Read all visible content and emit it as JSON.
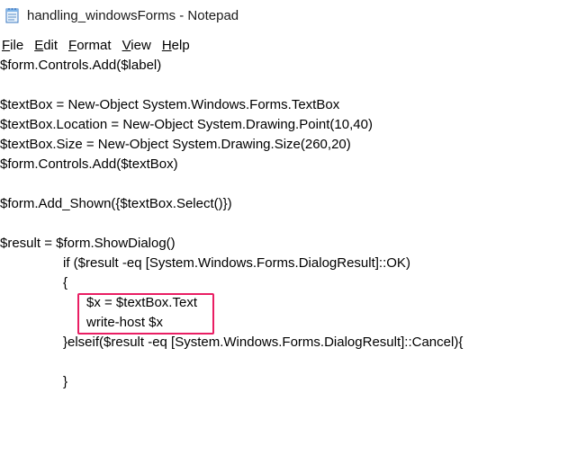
{
  "window": {
    "title": "handling_windowsForms - Notepad",
    "icon": "notepad-icon"
  },
  "menu": {
    "file": "File",
    "edit": "Edit",
    "format": "Format",
    "view": "View",
    "help": "Help"
  },
  "code": {
    "line1": "$form.Controls.Add($label)",
    "line2": "",
    "line3": "$textBox = New-Object System.Windows.Forms.TextBox",
    "line4": "$textBox.Location = New-Object System.Drawing.Point(10,40)",
    "line5": "$textBox.Size = New-Object System.Drawing.Size(260,20)",
    "line6": "$form.Controls.Add($textBox)",
    "line7": "",
    "line8": "$form.Add_Shown({$textBox.Select()})",
    "line9": "",
    "line10": "$result = $form.ShowDialog()",
    "line11": "if ($result -eq [System.Windows.Forms.DialogResult]::OK)",
    "line12": "{",
    "line13": "$x = $textBox.Text",
    "line14": "write-host $x",
    "line15": "}elseif($result -eq [System.Windows.Forms.DialogResult]::Cancel){",
    "line16": "",
    "line17": "}"
  },
  "colors": {
    "highlight_border": "#e91e63"
  }
}
